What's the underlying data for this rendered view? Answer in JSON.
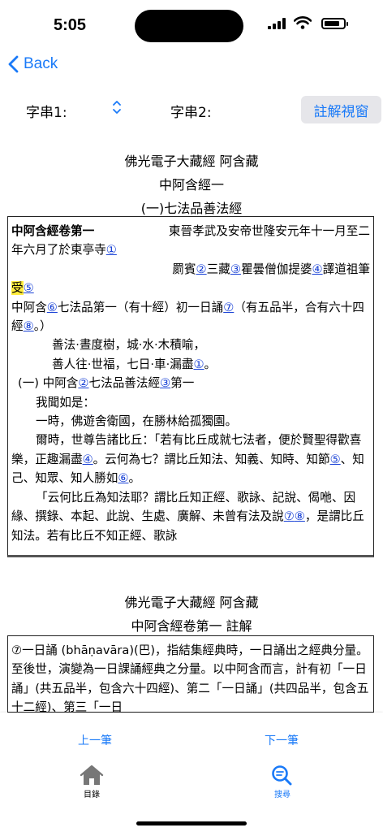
{
  "status": {
    "time": "5:05",
    "battery_level": 0.8
  },
  "nav": {
    "back_label": "Back"
  },
  "selectors": {
    "label1": "字串1:",
    "label2": "字串2:",
    "annot_button": "註解視窗"
  },
  "main_heading": {
    "line1": "佛光電子大藏經 阿含藏",
    "line2": "中阿含經一",
    "line3": "(一)七法品善法經"
  },
  "text": {
    "title": "中阿含經卷第一",
    "translation_head": "東晉孝武及安帝世隆安元年十一月至二",
    "translation_tail": "年六月了於東亭寺",
    "r1": "①",
    "translator_a": "罽賓",
    "r2": "②",
    "translator_b": "三藏",
    "r3": "③",
    "translator_c": "瞿曇僧伽提婆",
    "r4": "④",
    "translator_d": "譯道祖筆",
    "shou": "受",
    "r5": "⑤",
    "p1_a": "中阿含",
    "r6": "⑥",
    "p1_b": "七法品第一（有十經）初一日誦",
    "r7": "⑦",
    "p1_c": "（有五品半，",
    "p1_d": "合有六十四經",
    "r8": "⑧",
    "p1_e": "。）",
    "verse1": "善法·晝度樹，城·水·木積喻，",
    "verse2_a": "善人往·世福，七日·車·漏盡",
    "vr1": "①",
    "verse2_b": "。",
    "sec_a": "(一) 中阿含",
    "sr2": "②",
    "sec_b": "七法品善法經",
    "sr3": "③",
    "sec_c": "第一",
    "p2": "我聞如是：",
    "p3": "一時，佛遊舍衛國，在勝林給孤獨園。",
    "p4_a": "爾時，世尊告諸比丘：「若有比丘成就七法者，便於賢聖得歡喜樂，正趣漏盡",
    "pr4": "④",
    "p4_b": "。云何為七？謂比丘知法、知義、知時、知節",
    "pr5": "⑤",
    "p4_c": "、知己、知眾、知人勝如",
    "pr6": "⑥",
    "p4_d": "。",
    "p5": "「云何比丘為知法耶？謂比丘知正經、歌詠、記說、偈咃、因緣、撰錄、本起、此說、生處、廣解、未曾有法",
    "p6_a": "及說",
    "pr7": "⑦",
    "pr8": "⑧",
    "p6_b": "，是謂比丘知法。若有比丘不知正經、歌詠"
  },
  "annot_heading": {
    "line1": "佛光電子大藏經 阿含藏",
    "line2": "中阿含經卷第一 註解"
  },
  "annotation": {
    "text_a": "⑦一日誦 (bhāṇavāra)(巴)，指結集經典時，一日誦出之經典分量。至後世，演變為一日課誦經典之分量。以中阿含而言，計有初「一日誦」(共五品半，包含六十四經)、第二「一日誦」(共四品半，包含五十二經)、第三「一日"
  },
  "footer": {
    "prev_label": "上一筆",
    "next_label": "下一筆",
    "tab_home": "目錄",
    "tab_search": "搜尋"
  },
  "colors": {
    "accent": "#1a7af8",
    "ref": "#1b43d6",
    "highlight": "#ffec3d"
  }
}
